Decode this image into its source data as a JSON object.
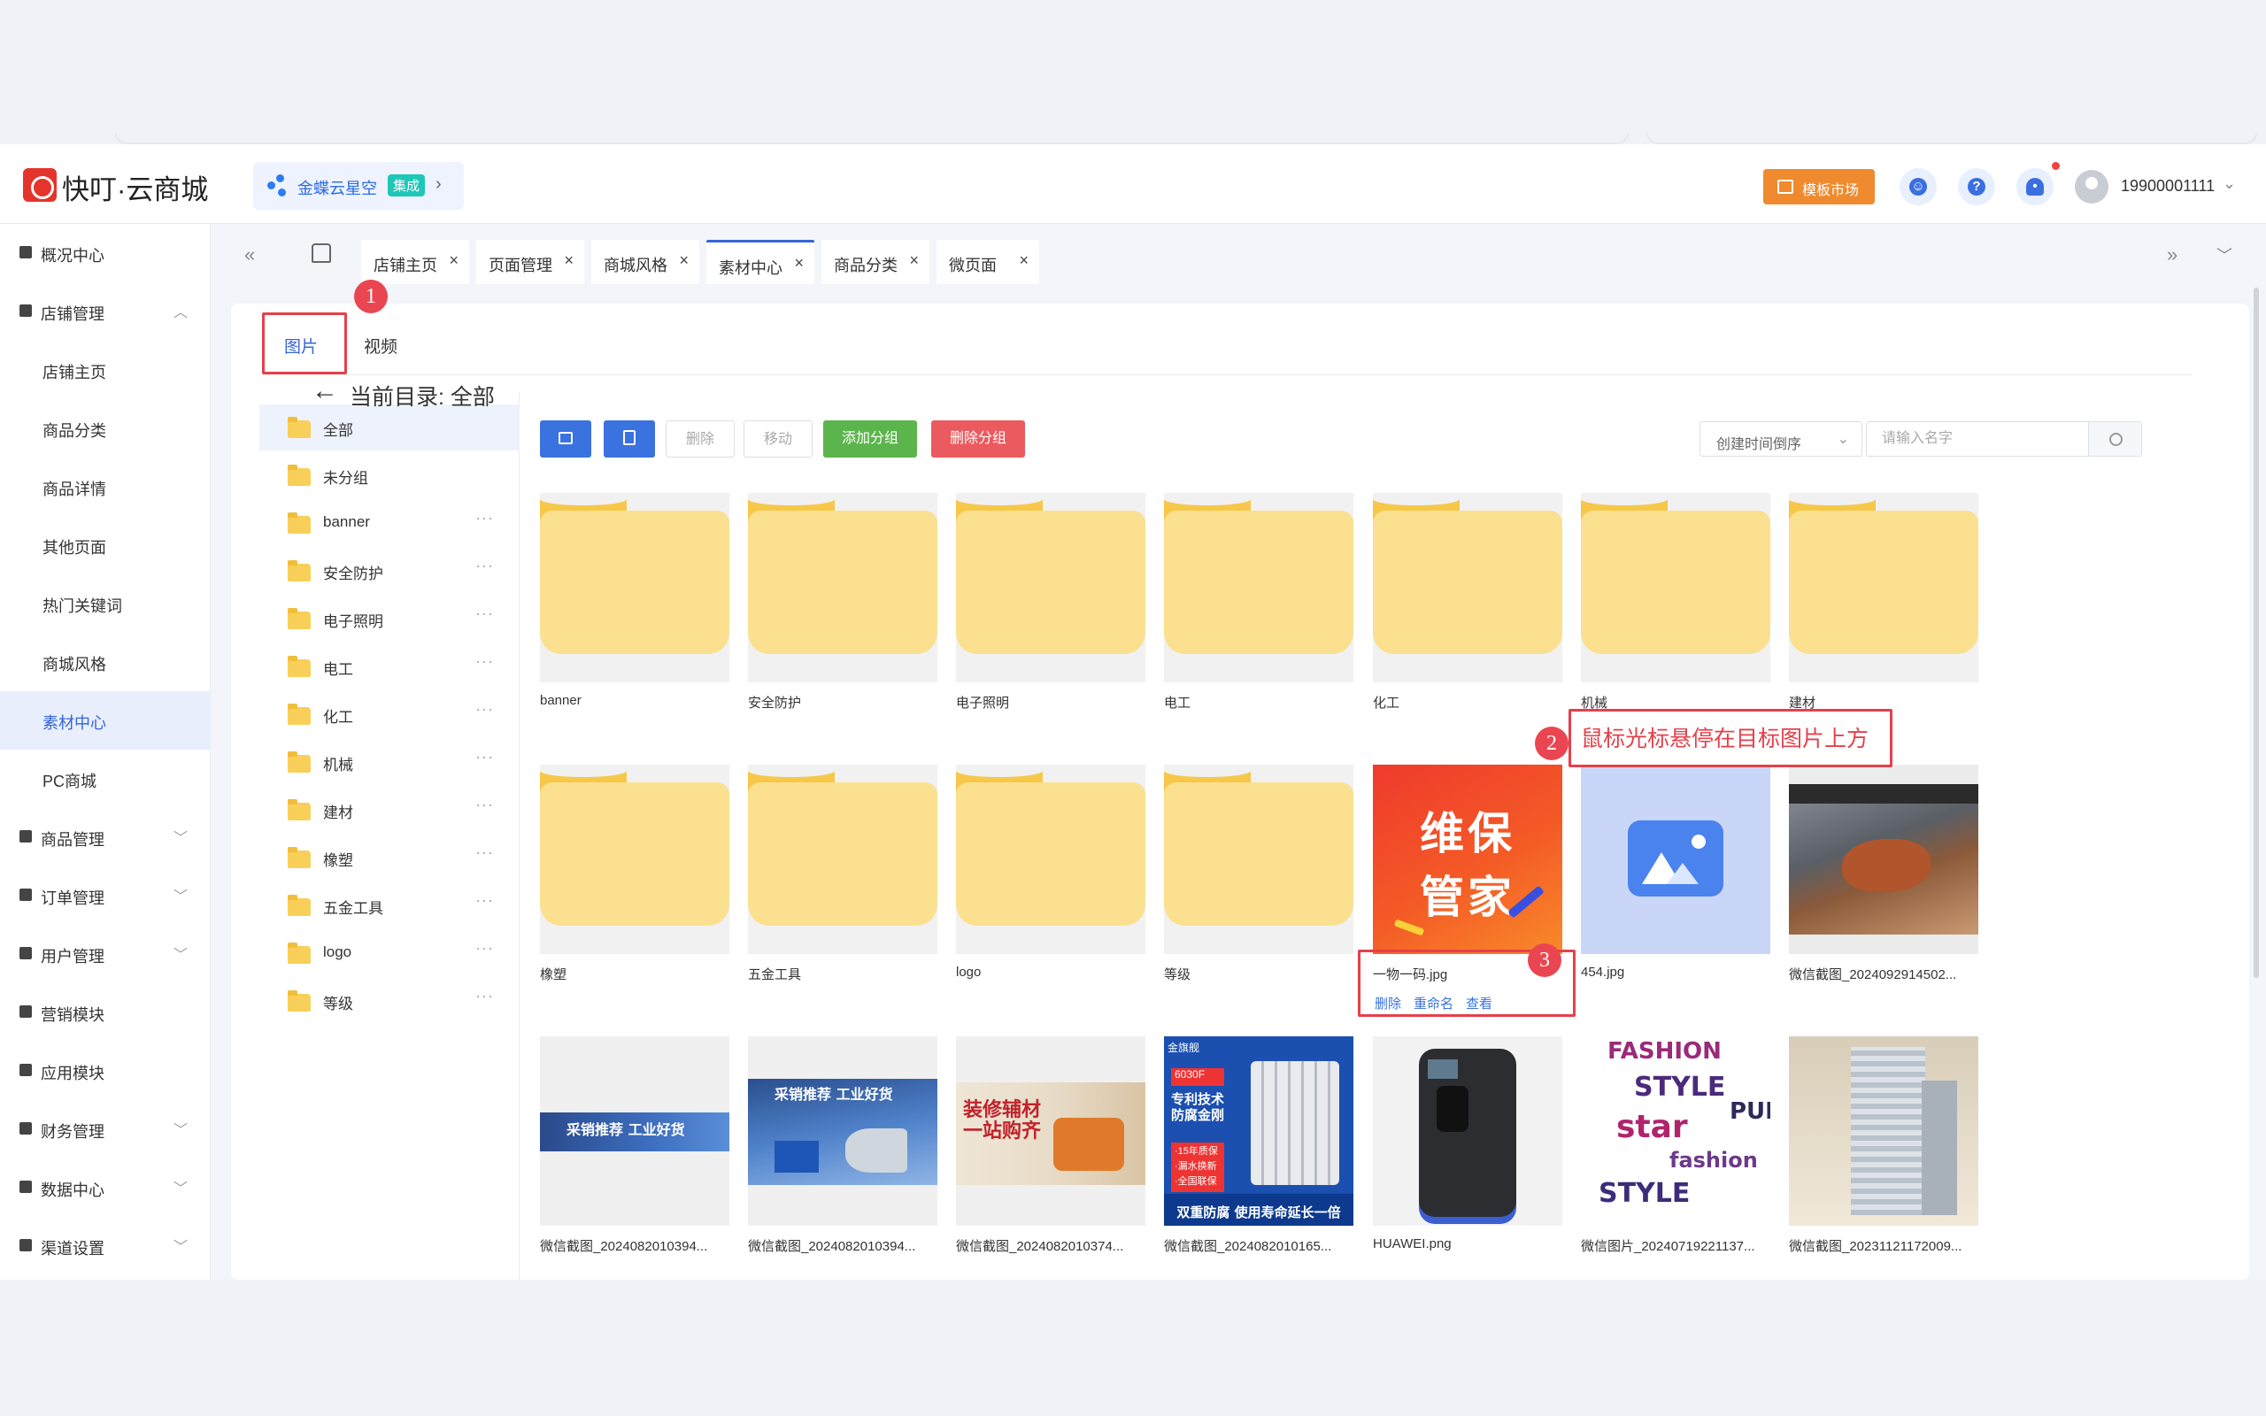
{
  "app": {
    "brand": "快叮·云商城",
    "integration": {
      "name": "金蝶云星空",
      "badge": "集成"
    },
    "template_market": "模板市场",
    "user": "19900001111",
    "accent": "#3665d9"
  },
  "sidebar": {
    "items": [
      {
        "label": "概况中心",
        "icon": "home-icon",
        "type": "group"
      },
      {
        "label": "店铺管理",
        "icon": "store-icon",
        "type": "group",
        "expanded": true
      },
      {
        "label": "店铺主页",
        "type": "sub"
      },
      {
        "label": "商品分类",
        "type": "sub"
      },
      {
        "label": "商品详情",
        "type": "sub"
      },
      {
        "label": "其他页面",
        "type": "sub"
      },
      {
        "label": "热门关键词",
        "type": "sub"
      },
      {
        "label": "商城风格",
        "type": "sub"
      },
      {
        "label": "素材中心",
        "type": "sub",
        "active": true
      },
      {
        "label": "PC商城",
        "type": "sub"
      },
      {
        "label": "商品管理",
        "icon": "goods-icon",
        "type": "group"
      },
      {
        "label": "订单管理",
        "icon": "order-icon",
        "type": "group"
      },
      {
        "label": "用户管理",
        "icon": "user-icon",
        "type": "group"
      },
      {
        "label": "营销模块",
        "icon": "marketing-icon",
        "type": "group"
      },
      {
        "label": "应用模块",
        "icon": "apps-icon",
        "type": "group"
      },
      {
        "label": "财务管理",
        "icon": "finance-icon",
        "type": "group"
      },
      {
        "label": "数据中心",
        "icon": "data-icon",
        "type": "group"
      },
      {
        "label": "渠道设置",
        "icon": "channel-icon",
        "type": "group"
      }
    ]
  },
  "page_tabs": [
    "店铺主页",
    "页面管理",
    "商城风格",
    "素材中心",
    "商品分类",
    "微页面"
  ],
  "active_page_tab": "素材中心",
  "media_tabs": [
    "图片",
    "视频"
  ],
  "active_media_tab": "图片",
  "folders": [
    "全部",
    "未分组",
    "banner",
    "安全防护",
    "电子照明",
    "电工",
    "化工",
    "机械",
    "建材",
    "橡塑",
    "五金工具",
    "logo",
    "等级"
  ],
  "current_dir": {
    "prefix": "当前目录:",
    "name": "全部"
  },
  "toolbar": {
    "delete": "删除",
    "move": "移动",
    "add_group": "添加分组",
    "delete_group": "删除分组",
    "sort": "创建时间倒序",
    "search_placeholder": "请输入名字"
  },
  "grid": {
    "row1": [
      "banner",
      "安全防护",
      "电子照明",
      "电工",
      "化工",
      "机械",
      "建材"
    ],
    "row2": [
      "橡塑",
      "五金工具",
      "logo",
      "等级",
      "一物一码.jpg",
      "454.jpg",
      "微信截图_2024092914502..."
    ],
    "row3": [
      "微信截图_2024082010394...",
      "微信截图_2024082010394...",
      "微信截图_2024082010374...",
      "微信截图_2024082010165...",
      "HUAWEI.png",
      "微信图片_20240719221137...",
      "微信截图_20231121172009..."
    ],
    "hover_actions": [
      "删除",
      "重命名",
      "查看"
    ]
  },
  "thumb_text": {
    "weibao_1": "维保",
    "weibao_2": "管家",
    "banner_title": "采销推荐 工业好货",
    "ban3_1": "装修辅材",
    "ban3_2": "一站购齐",
    "heater_store": "金旗舰",
    "heater_spec": "6030F",
    "heater_line1": "专利技术",
    "heater_line2": "防腐金刚",
    "heater_tags": [
      "·15年质保",
      "·漏水换新",
      "·全国联保"
    ],
    "heater_foot": "双重防腐 使用寿命延长一倍",
    "fashion": [
      "FASHION",
      "STYLE",
      "star",
      "fashion",
      "STYLE",
      "PUI"
    ]
  },
  "annotations": {
    "badges": [
      "1",
      "2",
      "3"
    ],
    "hint": "鼠标光标悬停在目标图片上方"
  }
}
